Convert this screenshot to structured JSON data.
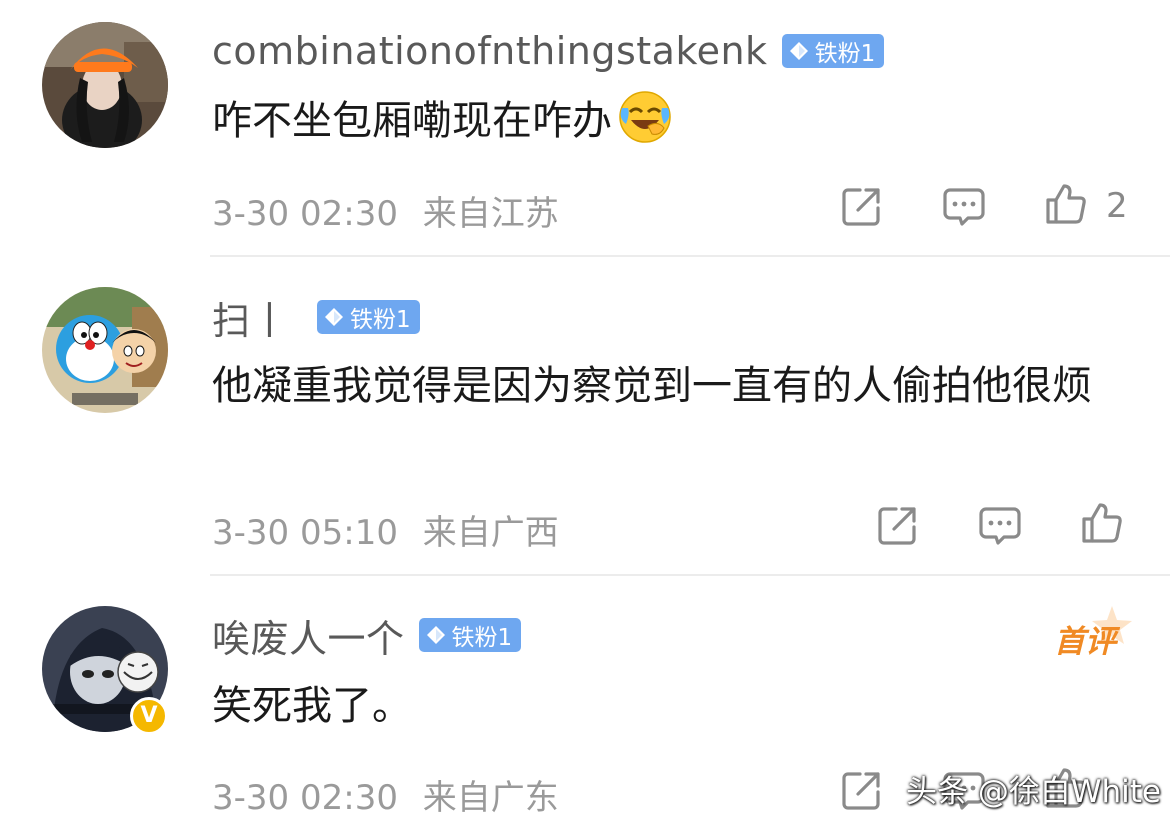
{
  "comments": [
    {
      "username": "combinationofnthingstakenk",
      "badge": "铁粉1",
      "text": "咋不坐包厢嘞现在咋办",
      "emoji": "face-with-tears-of-joy",
      "time": "3-30 02:30",
      "location": "来自江苏",
      "likes": "2",
      "verified": false,
      "first_comment": false
    },
    {
      "username": "扫丨",
      "badge": "铁粉1",
      "text": "他凝重我觉得是因为察觉到一直有的人偷拍他很烦",
      "time": "3-30 05:10",
      "location": "来自广西",
      "likes": "",
      "verified": false,
      "first_comment": false
    },
    {
      "username": "唉废人一个",
      "badge": "铁粉1",
      "text": "笑死我了。",
      "time": "3-30 02:30",
      "location": "来自广东",
      "likes": "",
      "verified": true,
      "verified_mark": "V",
      "first_comment": true,
      "first_comment_label": "首评"
    }
  ],
  "icons": {
    "share": "share-icon",
    "comment": "comment-icon",
    "like": "thumbs-up-icon",
    "badge_gem": "diamond-icon"
  },
  "colors": {
    "badge": "#6ea7f0",
    "meta_text": "#9a9a9a",
    "username": "#595959",
    "first_comment": "#f08a24",
    "verified": "#f5b800"
  },
  "watermark": "头条 @徐白White"
}
